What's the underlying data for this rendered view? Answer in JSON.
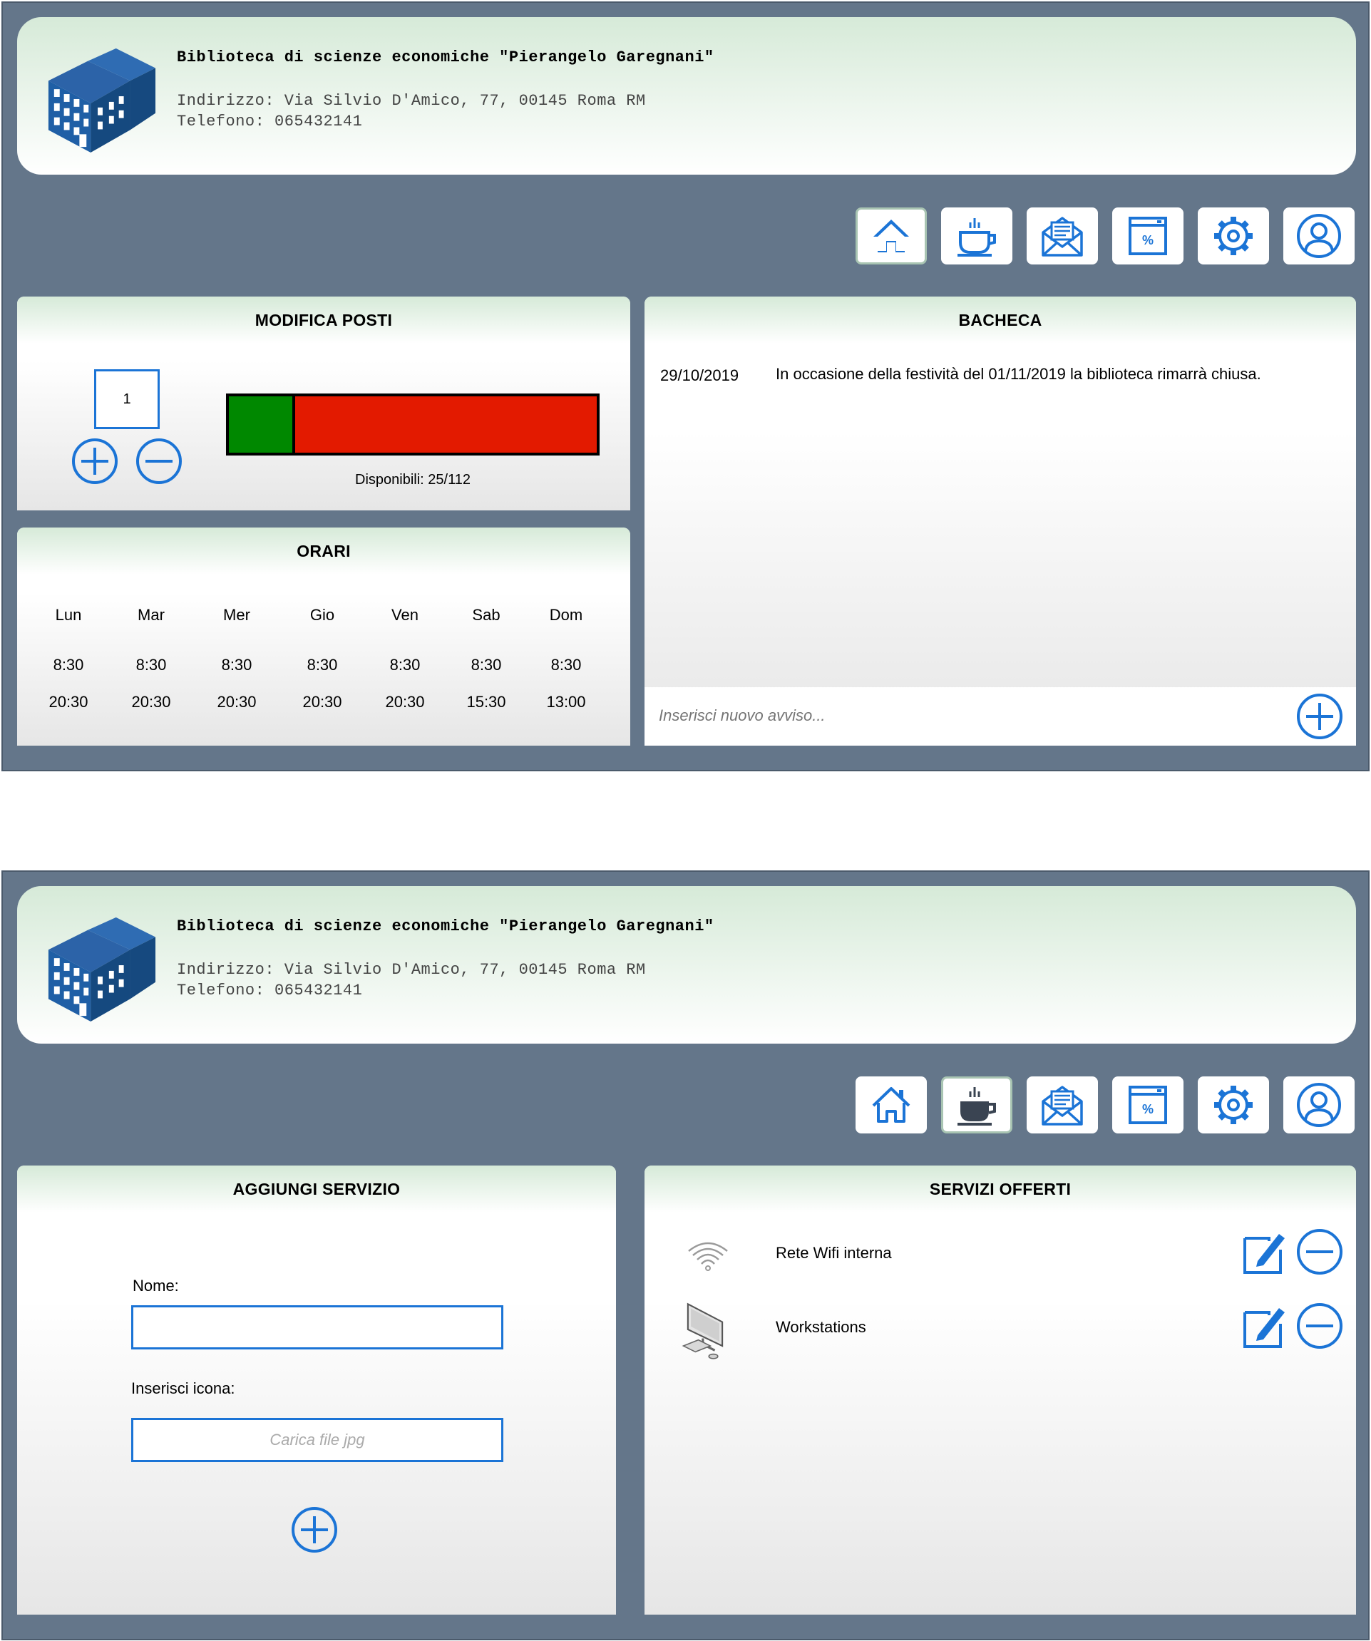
{
  "library": {
    "name": "Biblioteca di scienze economiche \"Pierangelo Garegnani\"",
    "address": "Indirizzo: Via Silvio D'Amico, 77, 00145 Roma RM",
    "phone": "Telefono: 065432141"
  },
  "nav": [
    "home-icon",
    "coffee-cup-icon",
    "newsletter-icon",
    "discount-calendar-icon",
    "gear-icon",
    "user-icon"
  ],
  "colors": {
    "primary_blue": "#1b74d6",
    "background": "#64768a",
    "available": "#008800",
    "occupied": "#e31a00"
  },
  "screen1": {
    "posti": {
      "title": "MODIFICA POSTI",
      "step_value": "1",
      "available_fraction": 0.18,
      "available_label": "Disponibili: 25/112"
    },
    "orari": {
      "title": "ORARI",
      "days": [
        "Lun",
        "Mar",
        "Mer",
        "Gio",
        "Ven",
        "Sab",
        "Dom"
      ],
      "open": [
        "8:30",
        "8:30",
        "8:30",
        "8:30",
        "8:30",
        "8:30",
        "8:30"
      ],
      "close": [
        "20:30",
        "20:30",
        "20:30",
        "20:30",
        "20:30",
        "15:30",
        "13:00"
      ]
    },
    "bacheca": {
      "title": "BACHECA",
      "notices": [
        {
          "date": "29/10/2019",
          "text": "In occasione della festività del 01/11/2019 la biblioteca rimarrà chiusa."
        }
      ],
      "input_placeholder": "Inserisci nuovo avviso..."
    }
  },
  "screen2": {
    "aggiungi": {
      "title": "AGGIUNGI SERVIZIO",
      "name_label": "Nome:",
      "name_value": "",
      "icon_label": "Inserisci icona:",
      "file_placeholder": "Carica file jpg"
    },
    "servizi": {
      "title": "SERVIZI OFFERTI",
      "items": [
        {
          "icon": "wifi-icon",
          "name": "Rete Wifi interna"
        },
        {
          "icon": "workstation-icon",
          "name": "Workstations"
        }
      ]
    }
  }
}
